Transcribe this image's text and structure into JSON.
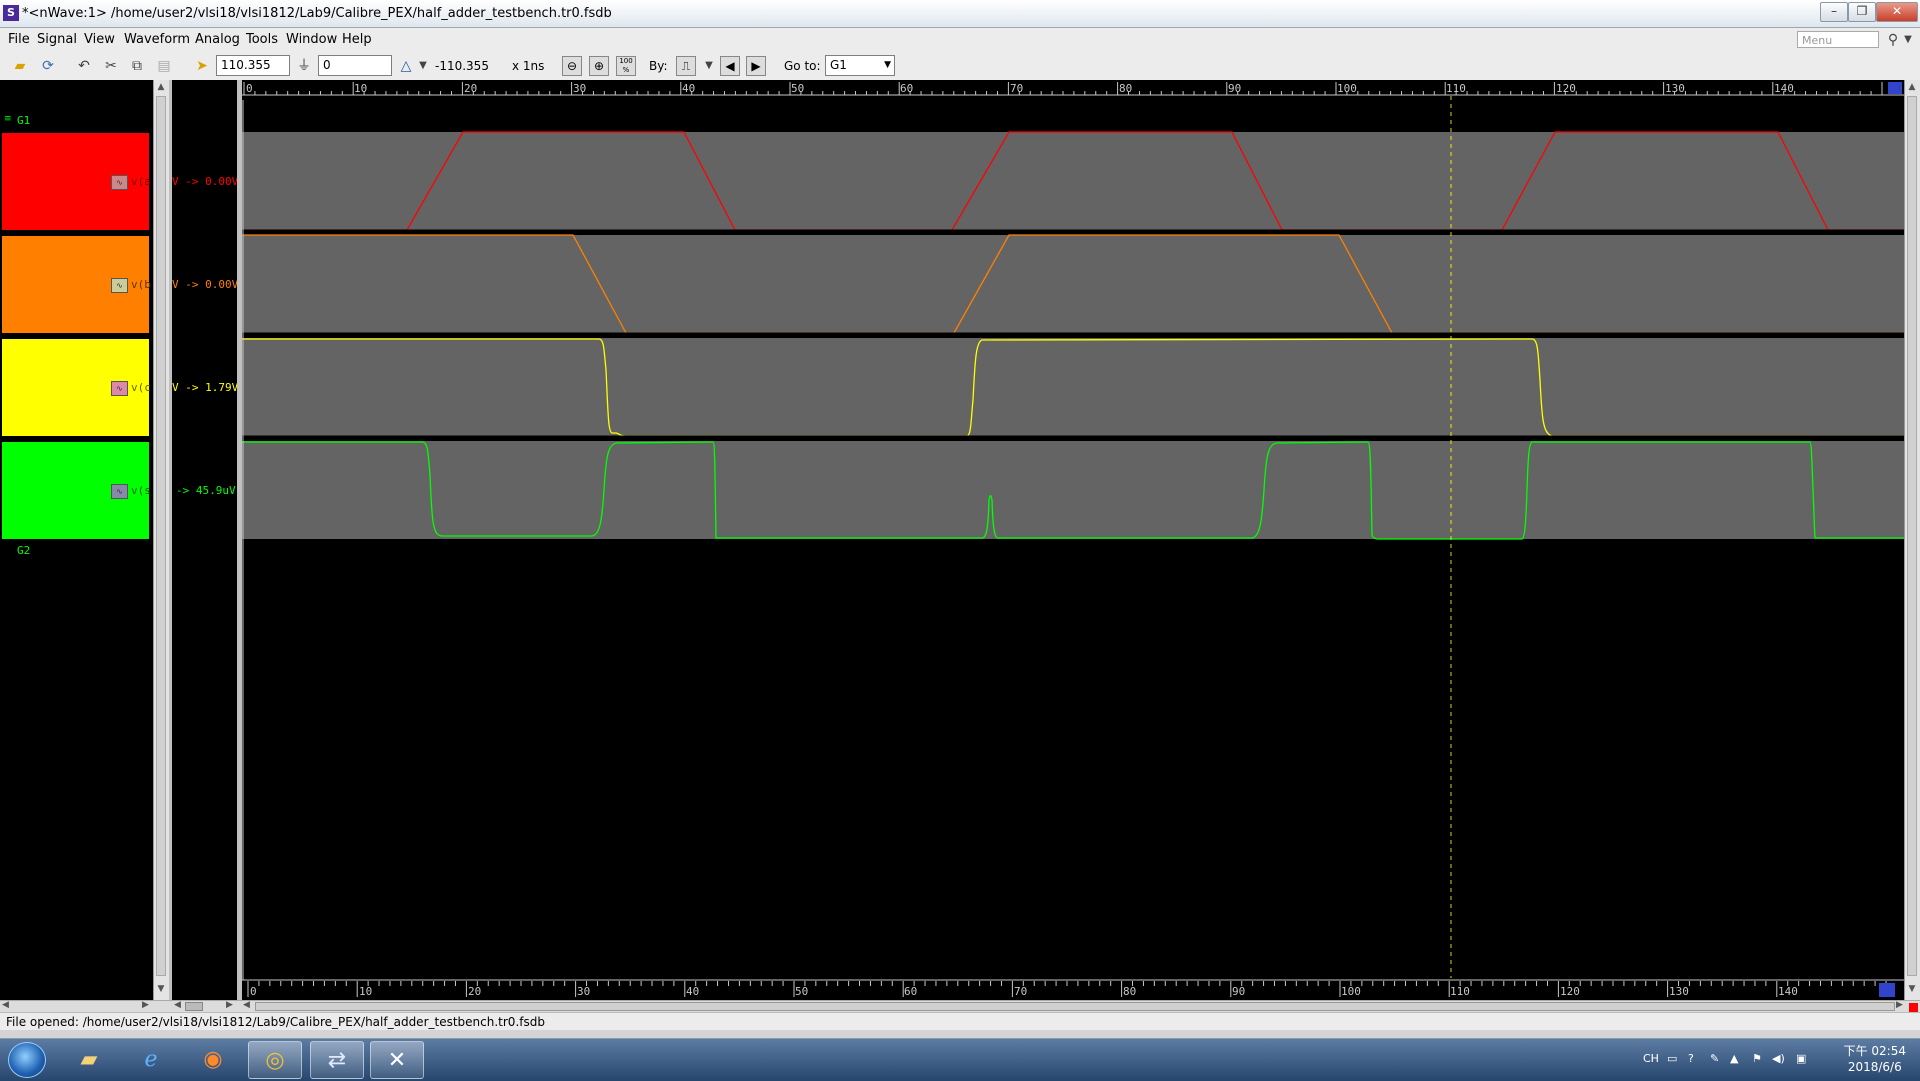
{
  "window": {
    "title": "*<nWave:1> /home/user2/vlsi18/vlsi1812/Lab9/Calibre_PEX/half_adder_testbench.tr0.fsdb",
    "app_icon": "S",
    "controls": {
      "minimize": "–",
      "restore": "❐",
      "close": "✕"
    }
  },
  "menu": {
    "items": [
      "File",
      "Signal",
      "View",
      "Waveform",
      "Analog",
      "Tools",
      "Window",
      "Help"
    ],
    "search_placeholder": "Menu"
  },
  "toolbar": {
    "cursor_time": "110.355",
    "marker_time": "0",
    "delta_time": "-110.355",
    "time_unit": "x 1ns",
    "by_label": "By:",
    "goto_label": "Go to:",
    "goto_value": "G1",
    "zoom_fit_label": "100 %"
  },
  "groups": {
    "g1": "G1",
    "g2": "G2"
  },
  "signals": [
    {
      "name": "v(a)",
      "value": "V -> 0.00V",
      "color": "#ff0000"
    },
    {
      "name": "v(b)",
      "value": "V -> 0.00V",
      "color": "#ff8000"
    },
    {
      "name": "v(c)",
      "value": "V -> 1.79V",
      "color": "#ffff00"
    },
    {
      "name": "v(s)",
      "value": "-> 45.9uV",
      "color": "#00ff00"
    }
  ],
  "ruler": {
    "labels": [
      "0",
      "10",
      "20",
      "30",
      "40",
      "50",
      "60",
      "70",
      "80",
      "90",
      "100",
      "110",
      "120",
      "130",
      "140"
    ]
  },
  "colors": {
    "waveform_background": "#646464",
    "cursor": "#ffff00"
  },
  "status": {
    "text": "File opened: /home/user2/vlsi18/vlsi1812/Lab9/Calibre_PEX/half_adder_testbench.tr0.fsdb"
  },
  "taskbar": {
    "apps": [
      "file-explorer",
      "internet-explorer",
      "firefox",
      "chrome",
      "network-tool",
      "x-server"
    ],
    "lang": "CH",
    "time": "下午 02:54",
    "date": "2018/6/6"
  }
}
